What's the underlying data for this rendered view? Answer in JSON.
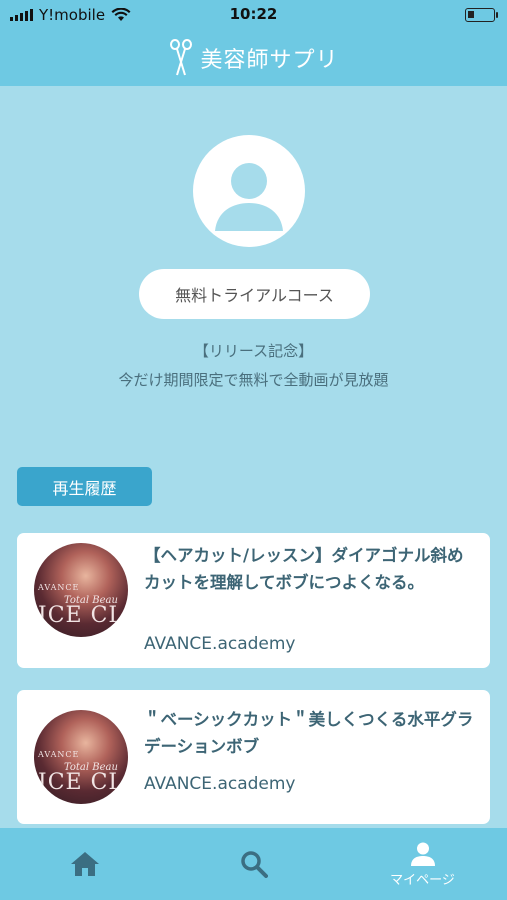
{
  "status_bar": {
    "carrier": "Y!mobile",
    "time": "10:22"
  },
  "header": {
    "title": "美容師サプリ",
    "icon": "scissors-icon"
  },
  "profile": {
    "avatar_icon": "user-icon",
    "course_label": "無料トライアルコース",
    "promo_line1": "【リリース記念】",
    "promo_line2": "今だけ期間限定で無料で全動画が見放題"
  },
  "history": {
    "label": "再生履歴",
    "items": [
      {
        "title": "【ヘアカット/レッスン】ダイアゴナル斜めカットを理解してボブにつよくなる。",
        "channel": "AVANCE.academy",
        "thumb_small": "AVANCE",
        "thumb_italic": "Total Beau",
        "thumb_big": "ICE CI"
      },
      {
        "title": "＂ベーシックカット＂美しくつくる水平グラデーションボブ",
        "channel": "AVANCE.academy",
        "thumb_small": "AVANCE",
        "thumb_italic": "Total Beau",
        "thumb_big": "ICE CI"
      }
    ]
  },
  "tab_bar": {
    "home_icon": "home-icon",
    "search_icon": "search-icon",
    "mypage_icon": "person-icon",
    "mypage_label": "マイページ"
  },
  "colors": {
    "nav": "#6ec9e3",
    "background": "#a6dceb",
    "accent": "#3aa5cc",
    "text": "#3d6575"
  }
}
